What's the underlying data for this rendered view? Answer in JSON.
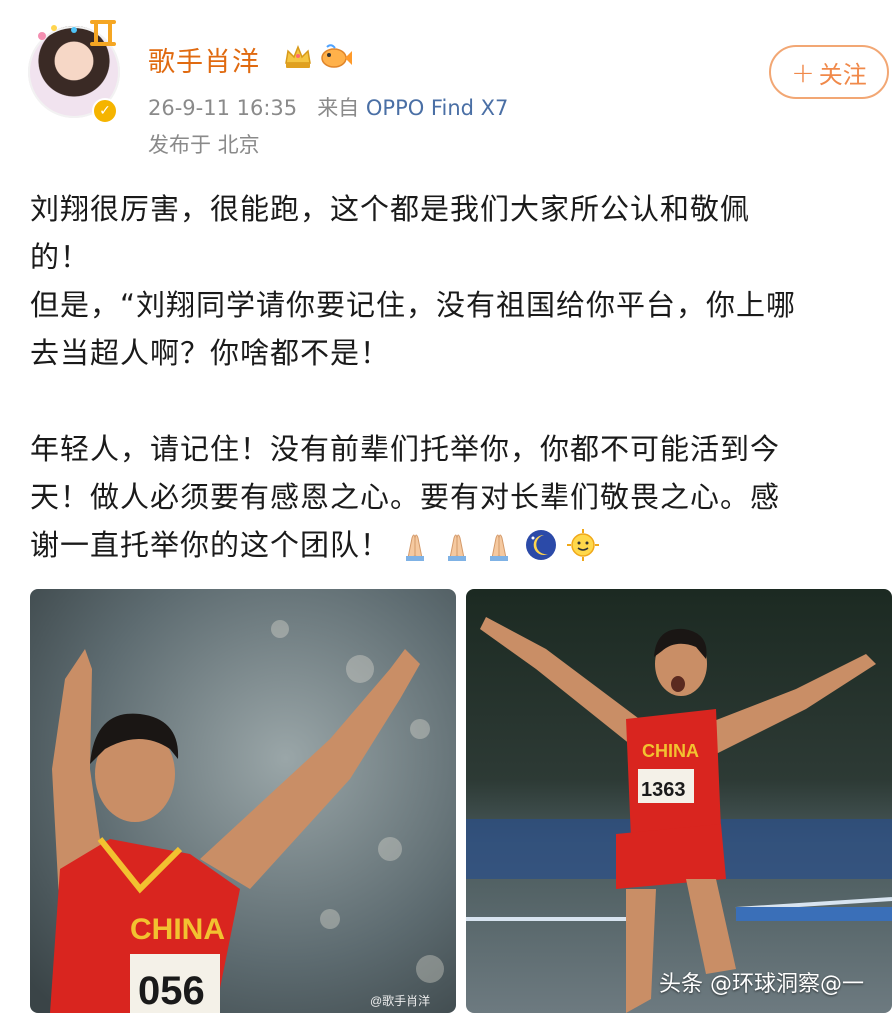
{
  "post": {
    "username": "歌手肖洋",
    "follow_label": "关注",
    "follow_plus": "+",
    "timestamp": "26-9-11 16:35",
    "source_prefix": "来自",
    "source_device": "OPPO Find X7",
    "location": "发布于 北京",
    "paragraphs": [
      "刘翔很厉害，很能跑，这个都是我们大家所公认和敬佩\n的！\n但是，“刘翔同学请你要记住，没有祖国给你平台，你上哪\n去当超人啊？你啥都不是！",
      "年轻人，请记住！没有前辈们托举你，你都不可能活到今\n天！做人必须要有感恩之心。要有对长辈们敬畏之心。感\n谢一直托举你的这个团队！"
    ],
    "emojis": [
      "pray-icon",
      "pray-icon",
      "pray-icon",
      "moon-icon",
      "sun-icon"
    ]
  },
  "images": {
    "left_jersey_text": "CHINA",
    "left_bib": "056",
    "left_watermark": "@歌手肖洋",
    "right_jersey_text": "CHINA",
    "right_bib": "1363"
  },
  "footer_watermark": "头条 @环球洞察@一",
  "colors": {
    "username": "#e06a10",
    "follow_border": "#f2a774",
    "meta": "#8a8a8a",
    "source_link": "#4a6fa5"
  }
}
